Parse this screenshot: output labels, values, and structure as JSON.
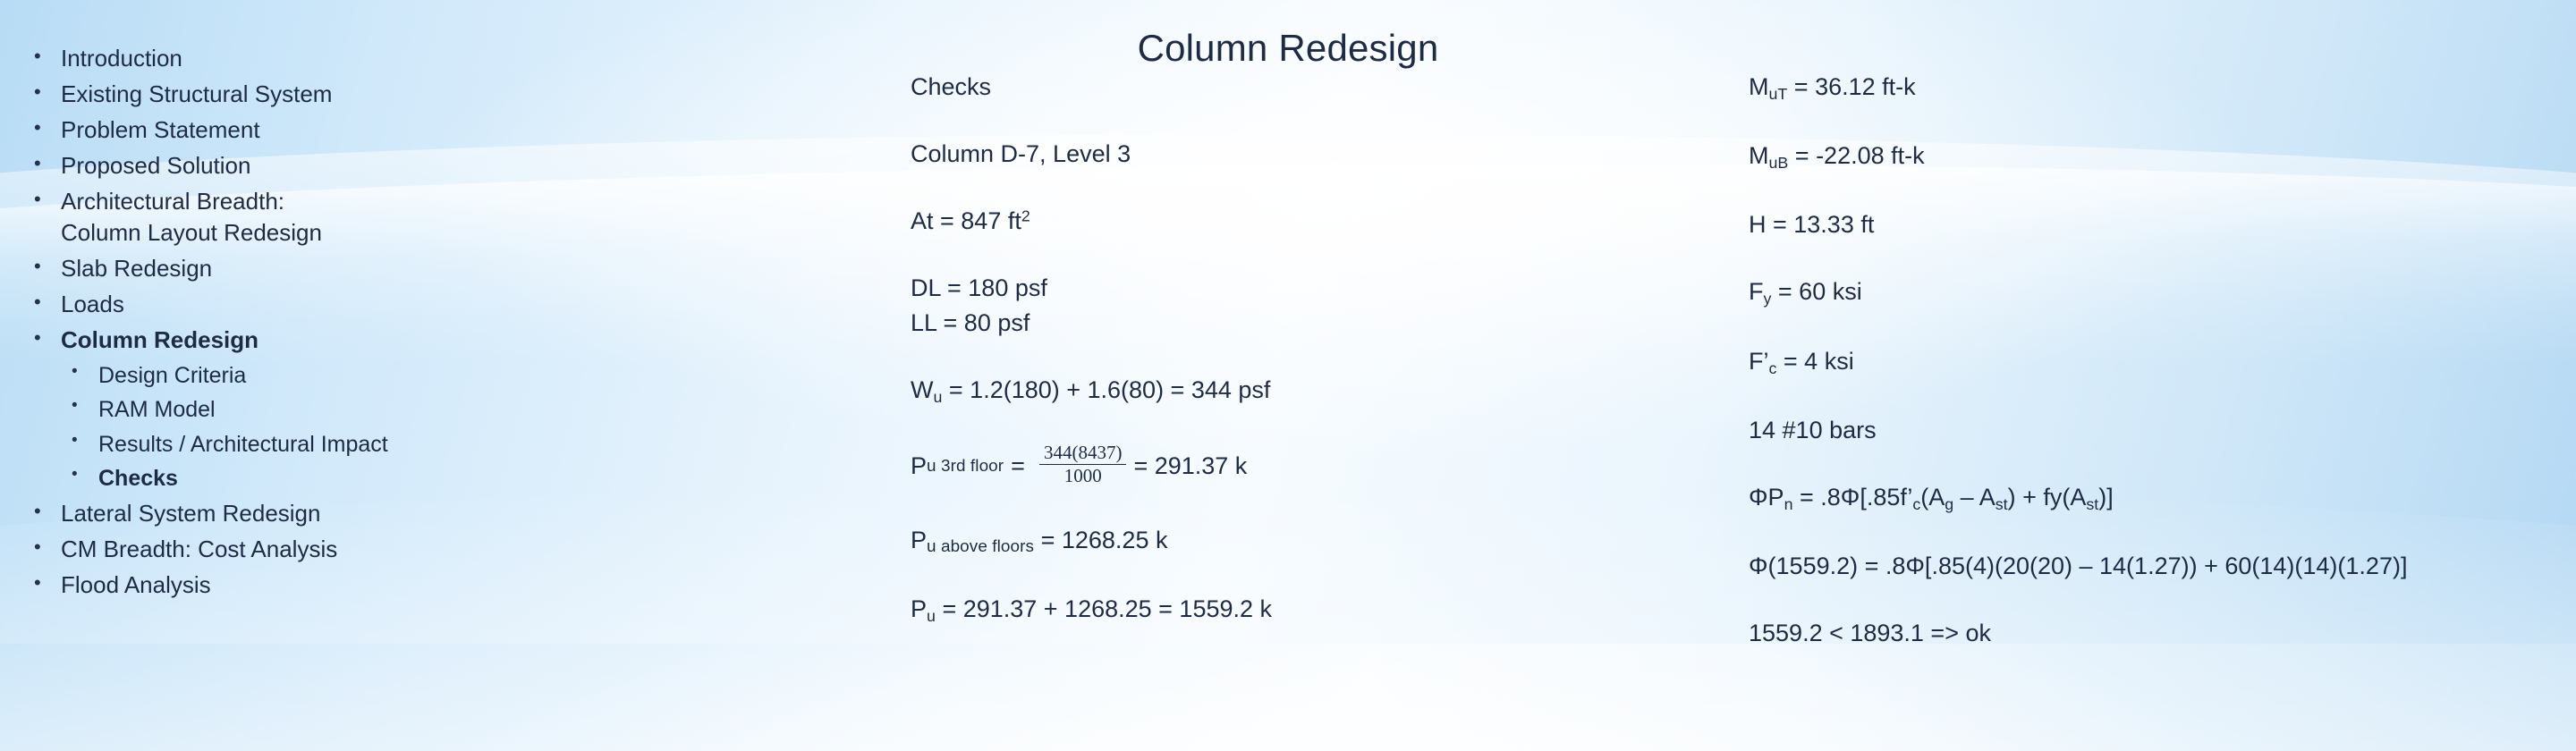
{
  "slide": {
    "title": "Column Redesign"
  },
  "outline": {
    "items": [
      {
        "label": "Introduction",
        "level": 1,
        "bold": false,
        "continuation": false
      },
      {
        "label": "Existing Structural System",
        "level": 1,
        "bold": false,
        "continuation": false
      },
      {
        "label": "Problem Statement",
        "level": 1,
        "bold": false,
        "continuation": false
      },
      {
        "label": "Proposed Solution",
        "level": 1,
        "bold": false,
        "continuation": false
      },
      {
        "label": "Architectural Breadth:",
        "level": 1,
        "bold": false,
        "continuation": false
      },
      {
        "label": "Column Layout Redesign",
        "level": 1,
        "bold": false,
        "continuation": true
      },
      {
        "label": "Slab Redesign",
        "level": 1,
        "bold": false,
        "continuation": false
      },
      {
        "label": "Loads",
        "level": 1,
        "bold": false,
        "continuation": false
      },
      {
        "label": "Column Redesign",
        "level": 1,
        "bold": true,
        "continuation": false
      },
      {
        "label": "Design Criteria",
        "level": 2,
        "bold": false,
        "continuation": false
      },
      {
        "label": "RAM Model",
        "level": 2,
        "bold": false,
        "continuation": false
      },
      {
        "label": "Results / Architectural Impact",
        "level": 2,
        "bold": false,
        "continuation": false
      },
      {
        "label": "Checks",
        "level": 2,
        "bold": true,
        "continuation": false
      },
      {
        "label": "Lateral System Redesign",
        "level": 1,
        "bold": false,
        "continuation": false
      },
      {
        "label": "CM Breadth: Cost Analysis",
        "level": 1,
        "bold": false,
        "continuation": false
      },
      {
        "label": "Flood Analysis",
        "level": 1,
        "bold": false,
        "continuation": false
      }
    ],
    "bullet_glyph": "•"
  },
  "middle_column": {
    "heading": "Checks",
    "location": "Column D-7, Level 3",
    "tributary_area_label": "At = 847 ft",
    "tributary_area_exponent": "2",
    "dead_load": "DL = 180 psf",
    "live_load": "LL = 80 psf",
    "factored_load_pre": "W",
    "factored_load_sub": "u",
    "factored_load_post": " = 1.2(180) + 1.6(80) = 344 psf",
    "pu_third_floor": {
      "symbol": "P",
      "subscript": "u 3rd floor",
      "equals": "=",
      "numerator": "344(8437)",
      "denominator": "1000",
      "result": "= 291.37 k"
    },
    "pu_above_floors": {
      "symbol": "P",
      "subscript": "u above floors",
      "value": " = 1268.25 k"
    },
    "pu_total": {
      "symbol": "P",
      "subscript": "u",
      "value": " = 291.37 + 1268.25 = 1559.2 k"
    }
  },
  "right_column": {
    "moment_top": {
      "symbol": "M",
      "subscript": "uT",
      "value": " = 36.12 ft-k"
    },
    "moment_bottom": {
      "symbol": "M",
      "subscript": "uB",
      "value": " = -22.08 ft-k"
    },
    "height": "H = 13.33 ft",
    "yield_strength": {
      "symbol": "F",
      "subscript": "y",
      "value": " = 60 ksi"
    },
    "concrete_strength": {
      "symbol": "F’",
      "subscript": "c",
      "value": " = 4 ksi"
    },
    "reinforcement": "14 #10 bars",
    "capacity_equation": {
      "parts": [
        {
          "t": "ΦP",
          "k": "t"
        },
        {
          "t": "n",
          "k": "sub"
        },
        {
          "t": " = .8Φ[.85f’",
          "k": "t"
        },
        {
          "t": "c",
          "k": "sub"
        },
        {
          "t": "(A",
          "k": "t"
        },
        {
          "t": "g",
          "k": "sub"
        },
        {
          "t": " – A",
          "k": "t"
        },
        {
          "t": "st",
          "k": "sub"
        },
        {
          "t": ") + fy(A",
          "k": "t"
        },
        {
          "t": "st",
          "k": "sub"
        },
        {
          "t": ")]",
          "k": "t"
        }
      ]
    },
    "capacity_substitution": "Φ(1559.2) = .8Φ[.85(4)(20(20) – 14(1.27)) + 60(14)(14)(1.27)]",
    "verdict": "1559.2 < 1893.1 => ok"
  }
}
